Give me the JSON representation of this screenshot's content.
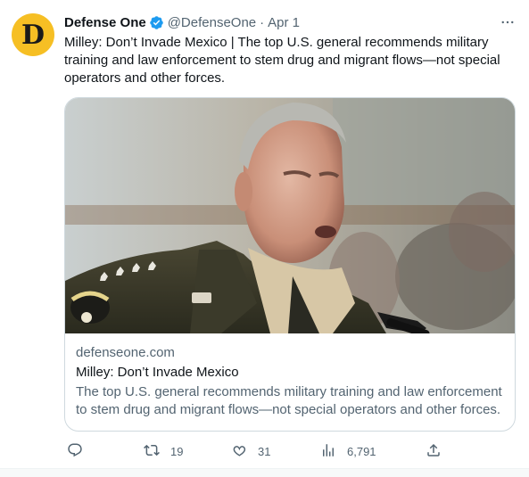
{
  "author": {
    "avatar_letter": "D",
    "display_name": "Defense One",
    "handle": "@DefenseOne",
    "separator": "·",
    "date": "Apr 1"
  },
  "tweet": {
    "text": "Milley: Don’t Invade Mexico | The top U.S. general recommends military training and law enforcement to stem drug and migrant flows—not special operators and other forces."
  },
  "card": {
    "image_icon": "photo-of-general-icon",
    "domain": "defenseone.com",
    "title": "Milley: Don’t Invade Mexico",
    "description": "The top U.S. general recommends military training and law enforcement to stem drug and migrant flows—not special operators and other forces."
  },
  "actions": {
    "reply": {
      "icon": "reply-icon",
      "count": ""
    },
    "retweet": {
      "icon": "retweet-icon",
      "count": "19"
    },
    "like": {
      "icon": "heart-icon",
      "count": "31"
    },
    "views": {
      "icon": "analytics-icon",
      "count": "6,791"
    },
    "share": {
      "icon": "share-icon",
      "count": ""
    }
  },
  "colors": {
    "avatar_bg": "#f6bf24",
    "verified": "#1d9bf0",
    "secondary_text": "#536471",
    "primary_text": "#0f1419"
  }
}
